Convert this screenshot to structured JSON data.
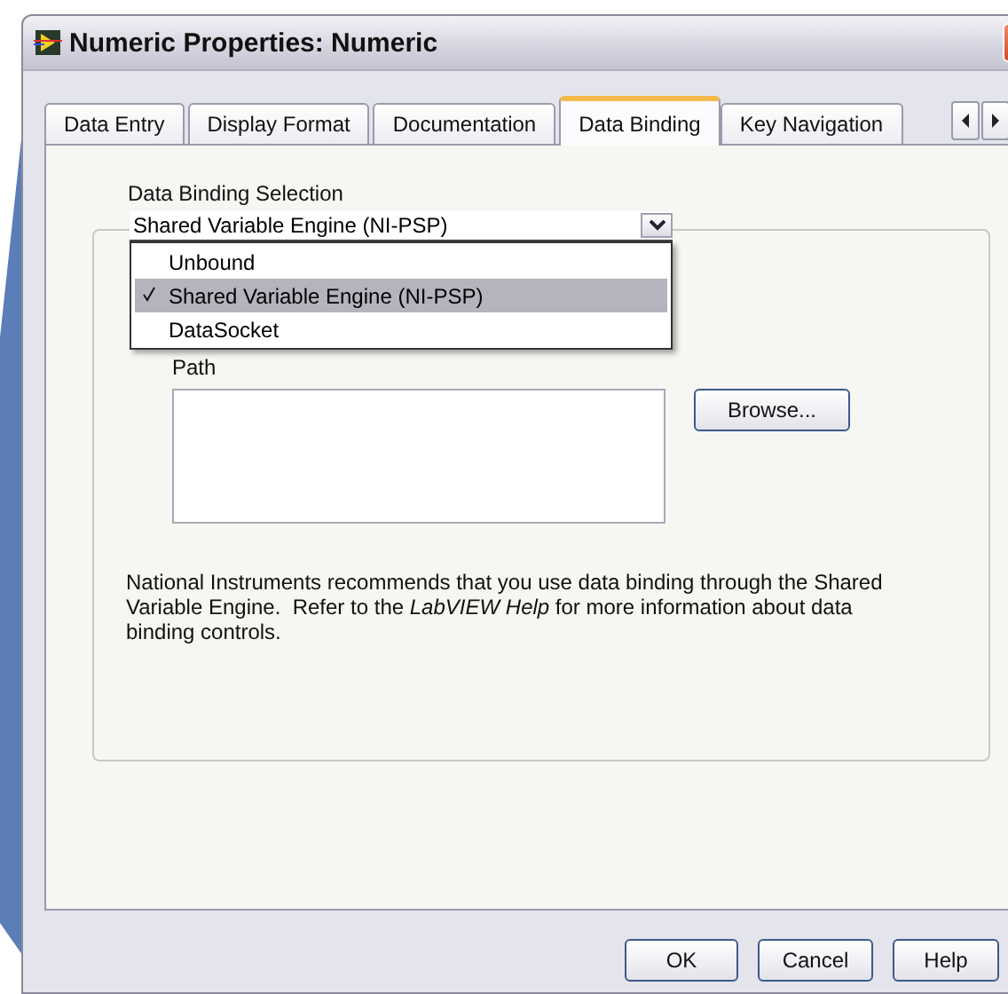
{
  "window": {
    "title": "Numeric Properties: Numeric"
  },
  "tabs": [
    {
      "label": "Data Entry",
      "selected": false
    },
    {
      "label": "Display Format",
      "selected": false
    },
    {
      "label": "Documentation",
      "selected": false
    },
    {
      "label": "Data Binding",
      "selected": true
    },
    {
      "label": "Key Navigation",
      "selected": false
    }
  ],
  "data_binding": {
    "label": "Data Binding Selection",
    "value": "Shared Variable Engine (NI-PSP)",
    "expanded": true,
    "options": [
      {
        "label": "Unbound",
        "selected": false
      },
      {
        "label": "Shared Variable Engine (NI-PSP)",
        "selected": true
      },
      {
        "label": "DataSocket",
        "selected": false
      }
    ]
  },
  "path": {
    "label": "Path"
  },
  "browse_button": "Browse...",
  "note": "National Instruments recommends that you use data binding through the Shared Variable Engine.  Refer to the *LabVIEW Help* for more information about data binding controls.",
  "buttons": [
    "OK",
    "Cancel",
    "Help"
  ]
}
